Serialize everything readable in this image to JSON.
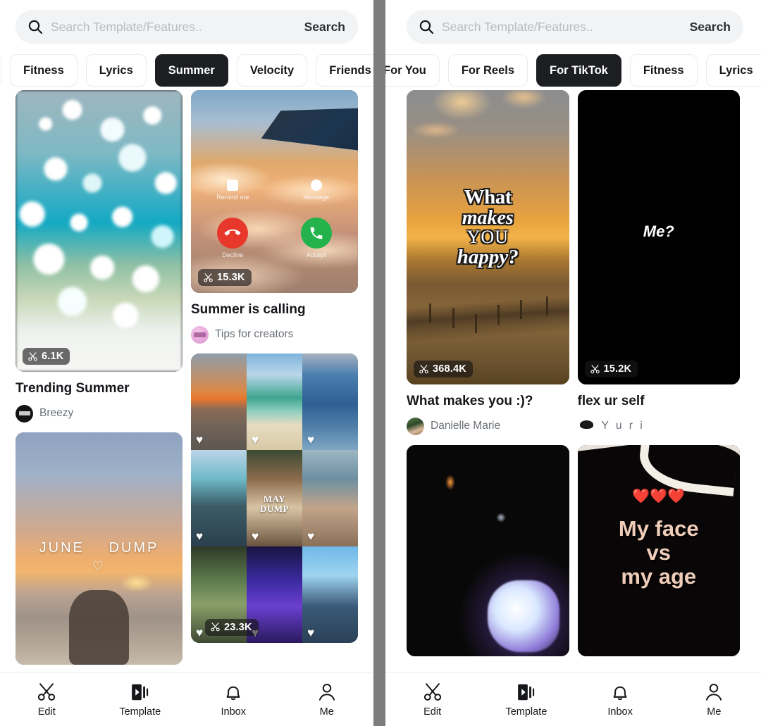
{
  "app": {
    "divider_color": "#7d7d7d",
    "accent_dark": "#1c1e21"
  },
  "panels": [
    {
      "id": "left",
      "search": {
        "placeholder": "Search Template/Features..",
        "value": "",
        "button_label": "Search",
        "icon": "search-icon"
      },
      "chips": [
        {
          "label": "Fitness",
          "active": false
        },
        {
          "label": "Lyrics",
          "active": false
        },
        {
          "label": "Summer",
          "active": true
        },
        {
          "label": "Velocity",
          "active": false
        },
        {
          "label": "Friends",
          "active": false
        }
      ],
      "columns": [
        {
          "cards": [
            {
              "art": "bokeh",
              "uses": "6.1K",
              "uses_icon": "scissors-icon",
              "title": "Trending Summer",
              "author": "Breezy",
              "author_avatar": "avatar-breezy",
              "title_visible": true
            },
            {
              "art": "june",
              "overlay_line1": "JUNE",
              "overlay_line2": "DUMP",
              "overlay_heart": "♡",
              "uses": "",
              "title": "",
              "author": "",
              "title_visible": false
            }
          ]
        },
        {
          "cards": [
            {
              "art": "plane",
              "uses": "15.3K",
              "uses_icon": "scissors-icon",
              "title": "Summer is calling",
              "author": "Tips for creators",
              "author_avatar": "avatar-tips",
              "title_visible": true,
              "call_ui": {
                "remind_label": "Remind me",
                "message_label": "Message",
                "decline_label": "Decline",
                "accept_label": "Accept"
              }
            },
            {
              "art": "collage",
              "uses": "23.3K",
              "uses_icon": "scissors-icon",
              "collage_caption_line1": "MAY",
              "collage_caption_line2": "DUMP",
              "title": "",
              "author": "",
              "title_visible": false
            }
          ]
        }
      ]
    },
    {
      "id": "right",
      "search": {
        "placeholder": "Search Template/Features..",
        "value": "",
        "button_label": "Search",
        "icon": "search-icon"
      },
      "chips": [
        {
          "label": "For You",
          "active": false
        },
        {
          "label": "For Reels",
          "active": false
        },
        {
          "label": "For TikTok",
          "active": true
        },
        {
          "label": "Fitness",
          "active": false
        },
        {
          "label": "Lyrics",
          "active": false
        }
      ],
      "columns": [
        {
          "cards": [
            {
              "art": "happy",
              "uses": "368.4K",
              "uses_icon": "scissors-icon",
              "overlay_w1": "What",
              "overlay_w2": "makes",
              "overlay_w3": "YOU",
              "overlay_w4": "happy?",
              "title": "What makes you :)?",
              "author": "Danielle Marie",
              "author_avatar": "avatar-dani",
              "title_visible": true
            },
            {
              "art": "dark",
              "uses": "",
              "title": "",
              "author": "",
              "title_visible": false
            }
          ]
        },
        {
          "cards": [
            {
              "art": "black",
              "overlay_text": "Me?",
              "uses": "15.2K",
              "uses_icon": "scissors-icon",
              "title": "flex ur self",
              "author": "Y u r i",
              "author_avatar": "avatar-yuri",
              "author_spaced": true,
              "title_visible": true
            },
            {
              "art": "face",
              "overlay_l1": "My face",
              "overlay_l2": "vs",
              "overlay_l3": "my age",
              "hearts": "❤️❤️❤️",
              "uses": "",
              "title": "",
              "author": "",
              "title_visible": false
            }
          ]
        }
      ]
    }
  ],
  "bottom_nav": {
    "items": [
      {
        "label": "Edit",
        "icon": "scissors-icon",
        "active": false
      },
      {
        "label": "Template",
        "icon": "template-play-icon",
        "active": true
      },
      {
        "label": "Inbox",
        "icon": "bell-icon",
        "active": false
      },
      {
        "label": "Me",
        "icon": "person-icon",
        "active": false
      }
    ]
  }
}
